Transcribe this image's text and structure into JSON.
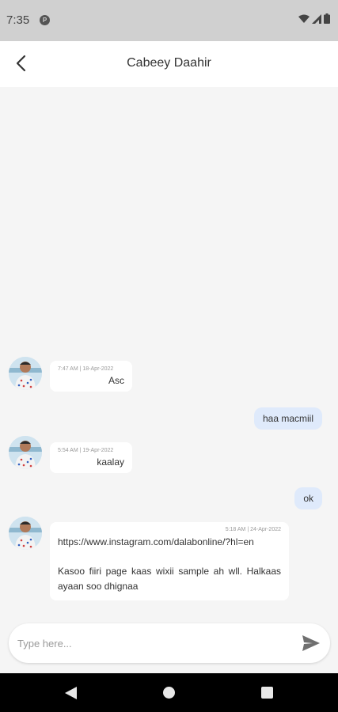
{
  "status_bar": {
    "time": "7:35",
    "app_icon_letter": "P",
    "icons": [
      "wifi-icon",
      "signal-icon",
      "battery-icon"
    ]
  },
  "header": {
    "title": "Cabeey Daahir",
    "back_icon": "chevron-left-icon"
  },
  "messages": [
    {
      "direction": "incoming",
      "meta": "7:47 AM | 18-Apr-2022",
      "text": "Asc"
    },
    {
      "direction": "outgoing",
      "text": "haa macmiil"
    },
    {
      "direction": "incoming",
      "meta": "5:54 AM | 19-Apr-2022",
      "text": "kaalay"
    },
    {
      "direction": "outgoing",
      "text": "ok"
    },
    {
      "direction": "incoming",
      "meta": "5:18 AM | 24-Apr-2022",
      "link": "https://www.instagram.com/dalabonline/?hl=en",
      "text": "Kasoo fiiri page kaas wixii sample ah wll. Halkaas ayaan soo dhignaa"
    }
  ],
  "composer": {
    "placeholder": "Type here...",
    "value": "",
    "send_icon": "send-icon"
  },
  "nav_bar": {
    "icons": [
      "nav-back-icon",
      "nav-home-icon",
      "nav-recents-icon"
    ]
  },
  "colors": {
    "status_bar_bg": "#d0d0d0",
    "chat_bg": "#f5f5f5",
    "incoming_bubble": "#ffffff",
    "outgoing_bubble": "#dfeafb",
    "nav_bar_bg": "#000000"
  }
}
